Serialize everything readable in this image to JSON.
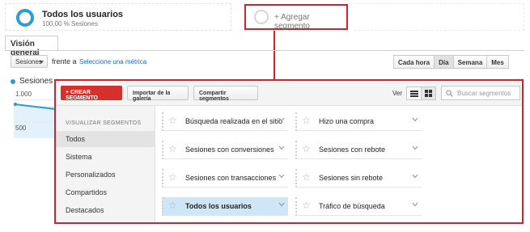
{
  "segments": {
    "active": {
      "title": "Todos los usuarios",
      "subtitle": "100,00 % Sesiones",
      "color": "#2f9bd6"
    },
    "add_label": "+ Agregar segmento"
  },
  "tabs": [
    {
      "label": "Visión general"
    }
  ],
  "toolbar": {
    "metric_value": "Sesiones",
    "versus_label": "frente a",
    "select_metric_link": "Seleccione una métrica",
    "periods": [
      "Cada hora",
      "Día",
      "Semana",
      "Mes"
    ],
    "active_period": "Día"
  },
  "chart": {
    "legend": "Sesiones",
    "ticks": [
      "1.000",
      "500"
    ],
    "color": "#2f9bd6"
  },
  "panel": {
    "create_button": "+ CREAR SEGMENTO",
    "import_button": "Importar de la galería",
    "share_button": "Compartir segmentos",
    "view_label": "Ver",
    "search_placeholder": "Buscar segmentos",
    "sidebar_title": "VISUALIZAR SEGMENTOS",
    "sidebar_items": [
      "Todos",
      "Sistema",
      "Personalizados",
      "Compartidos",
      "Destacados"
    ],
    "active_sidebar_item": "Todos",
    "segment_rows": [
      [
        "Búsqueda realizada en el sitio",
        "Hizo una compra"
      ],
      [
        "Sesiones con conversiones",
        "Sesiones con rebote"
      ],
      [
        "Sesiones con transacciones",
        "Sesiones sin rebote"
      ],
      [
        "Todos los usuarios",
        "Tráfico de búsqueda"
      ]
    ],
    "selected_segment": "Todos los usuarios",
    "accent_color": "#d5202e",
    "create_color": "#d5302a"
  }
}
